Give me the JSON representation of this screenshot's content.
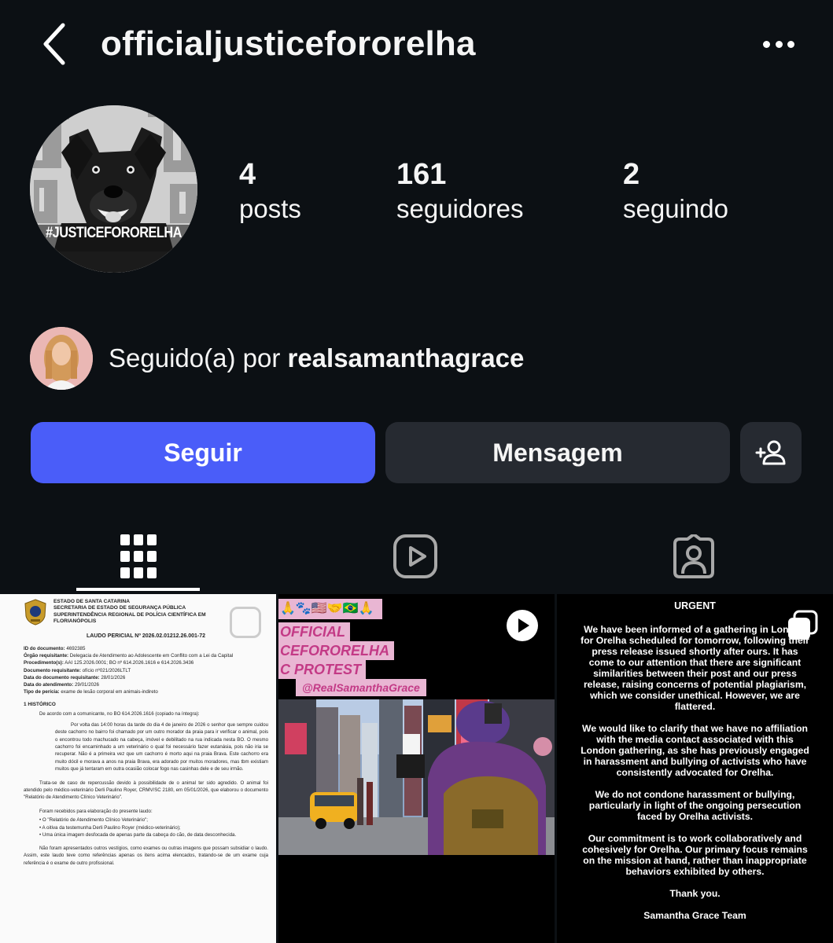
{
  "header": {
    "username": "officialjusticefororelha",
    "back_icon": "chevron-left-icon",
    "more_icon": "more-horizontal-icon"
  },
  "profile": {
    "avatar_text": "#JUSTICEFORORELHA",
    "stats": {
      "posts_count": "4",
      "posts_label": "posts",
      "followers_count": "161",
      "followers_label": "seguidores",
      "following_count": "2",
      "following_label": "seguindo"
    },
    "followed_by_prefix": "Seguido(a) por",
    "followed_by_user": "realsamanthagrace"
  },
  "actions": {
    "follow_label": "Seguir",
    "message_label": "Mensagem",
    "add_user_icon": "add-user-icon"
  },
  "tabs": [
    {
      "name": "grid",
      "icon": "grid-icon",
      "active": true
    },
    {
      "name": "reels",
      "icon": "reels-icon",
      "active": false
    },
    {
      "name": "tagged",
      "icon": "tagged-icon",
      "active": false
    }
  ],
  "posts": {
    "doc": {
      "org_1": "ESTADO DE SANTA CATARINA",
      "org_2": "SECRETARIA DE ESTADO DE SEGURANÇA PÚBLICA",
      "org_3": "SUPERINTENDÊNCIA REGIONAL DE POLÍCIA CIENTÍFICA EM",
      "org_4": "FLORIANÓPOLIS",
      "title": "LAUDO PERICIAL Nº 2026.02.01212.26.001-72",
      "fields": [
        {
          "k": "ID do documento:",
          "v": " 4692385"
        },
        {
          "k": "Órgão requisitante:",
          "v": " Delegacia de Atendimento ao Adolescente em Conflito com a Lei da Capital"
        },
        {
          "k": "Procedimento(s):",
          "v": " AAI 125.2026.0001; BO nº 614.2026.1616 e 614.2026.3436"
        },
        {
          "k": "Documento requisitante:",
          "v": " ofício nº021/2026LTLT"
        },
        {
          "k": "Data do documento requisitante:",
          "v": " 28/01/2026"
        },
        {
          "k": "Data do atendimento:",
          "v": " 29/01/2026"
        },
        {
          "k": "Tipo de perícia:",
          "v": " exame de lesão corporal em animais-indireto"
        }
      ],
      "section": "1 HISTÓRICO",
      "intro": "De acordo com a comunicante, no BO 614.2026.1616 (copiado na íntegra):",
      "p1": "Por volta das 14:00 horas da tarde do dia 4 de janeiro de 2026 o senhor que sempre cuidou deste cachorro no bairro foi chamado por um outro morador da praia para ir verificar o animal, pois o encontrou todo machucado na cabeça, imóvel e debilitado na rua indicada nesta BO. O mesmo cachorro foi encaminhado a um veterinário o qual foi necessário fazer eutanásia, pois não iria se recuperar. Não é a primeira vez que um cachorro é morto aqui na praia Brava. Este cachorro era muito dócil e morava a anos na praia Brava, era adorado por muitos moradores, mas tbm existiam muitos que já tentaram em outra ocasião colocar fogo nas casinhas dele e de seu irmão.",
      "p2": "Trata-se de caso de repercussão devido à possibilidade de o animal ter sido agredido. O animal foi atendido pelo médico-veterinário Derli Paulino Royer, CRMV/SC 2180, em 05/01/2026, que elaborou o documento \"Relatório de Atendimento Clínico Veterinário\".",
      "p3": "Foram recebidos para elaboração do presente laudo:",
      "bullets": [
        "O \"Relatório de Atendimento Clínico Veterinário\";",
        "A oitiva da testemunha Derli Paulino Royer (médico-veterinário);",
        "Uma única imagem desfocada de apenas parte da cabeça do cão, de data desconhecida."
      ],
      "p4": "Não foram apresentados outros vestígios, como exames ou outras imagens que possam subsidiar o laudo. Assim, este laudo teve como referências apenas os itens acima elencados, tratando-se de um exame cuja referência é o exame de outro profissional."
    },
    "protest": {
      "emoji": "🙏🐾🇺🇸🤝🇧🇷🙏",
      "line1": "OFFICIAL",
      "line2": "CEFORORELHA",
      "line3": "C PROTEST",
      "handle": "@RealSamanthaGrace",
      "overlay_icon": "play-icon"
    },
    "statement": {
      "heading": "URGENT",
      "p1": "We have been informed of a gathering in London for Orelha scheduled for tomorrow, following their press release issued shortly after ours. It has come to our attention that there are significant similarities between their post and our press release, raising concerns of potential plagiarism, which we consider unethical. However, we are flattered.",
      "p2": "We would like to clarify that we have no affiliation with the media contact associated with this London gathering, as she has previously engaged in harassment and bullying of activists who have consistently advocated for Orelha.",
      "p3": "We do not condone harassment or bullying, particularly in light of the ongoing persecution faced by Orelha activists.",
      "p4": "Our commitment is to work collaboratively and cohesively for Orelha. Our primary focus remains on the mission at hand, rather than inappropriate behaviors exhibited by others.",
      "p5": "Thank you.",
      "sign": "Samantha Grace Team",
      "overlay_icon": "carousel-icon"
    }
  },
  "colors": {
    "background": "#0c1014",
    "follow_button": "#4a5df9",
    "secondary_button": "#262a31",
    "text": "#f5f5f5"
  }
}
